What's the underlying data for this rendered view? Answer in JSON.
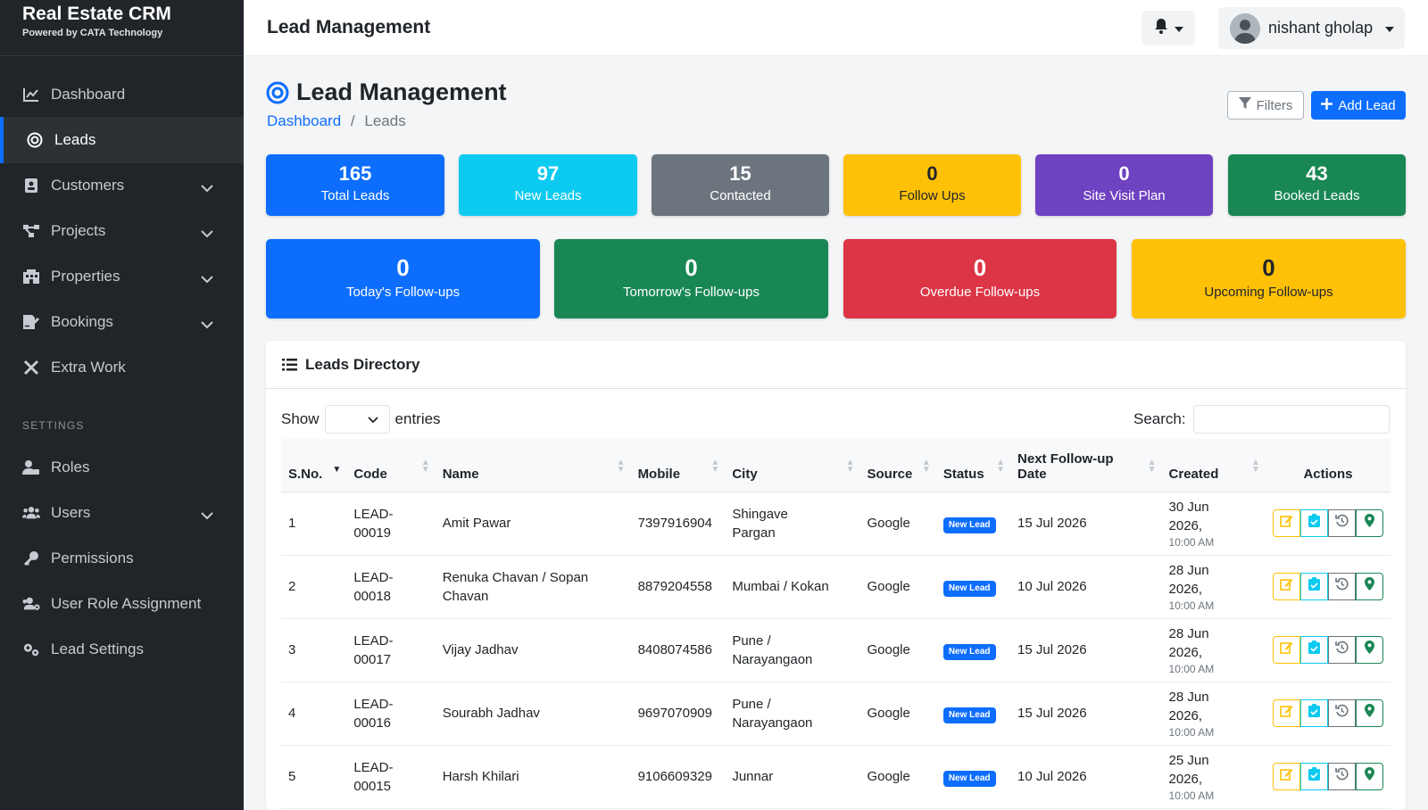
{
  "brand": {
    "title": "Real Estate CRM",
    "subtitle": "Powered by CATA Technology"
  },
  "sidebar": {
    "items": [
      {
        "label": "Dashboard",
        "icon": "chart-line-icon"
      },
      {
        "label": "Leads",
        "icon": "target-icon",
        "active": true
      },
      {
        "label": "Customers",
        "icon": "address-book-icon",
        "expandable": true
      },
      {
        "label": "Projects",
        "icon": "project-diagram-icon",
        "expandable": true
      },
      {
        "label": "Properties",
        "icon": "building-icon",
        "expandable": true
      },
      {
        "label": "Bookings",
        "icon": "file-signature-icon",
        "expandable": true
      },
      {
        "label": "Extra Work",
        "icon": "tools-icon"
      }
    ],
    "section_label": "SETTINGS",
    "settings_items": [
      {
        "label": "Roles",
        "icon": "user-tag-icon"
      },
      {
        "label": "Users",
        "icon": "users-icon",
        "expandable": true
      },
      {
        "label": "Permissions",
        "icon": "key-icon"
      },
      {
        "label": "User Role Assignment",
        "icon": "users-cog-icon"
      },
      {
        "label": "Lead Settings",
        "icon": "cogs-icon"
      }
    ]
  },
  "topbar": {
    "title": "Lead Management",
    "user_name": "nishant gholap"
  },
  "page": {
    "title": "Lead Management",
    "breadcrumb": {
      "home": "Dashboard",
      "separator": "/",
      "current": "Leads"
    },
    "filters_label": "Filters",
    "add_label": "Add Lead"
  },
  "stats_row1": [
    {
      "value": "165",
      "label": "Total Leads",
      "color": "#0d6efd"
    },
    {
      "value": "97",
      "label": "New Leads",
      "color": "#0dcaf0"
    },
    {
      "value": "15",
      "label": "Contacted",
      "color": "#6c757d"
    },
    {
      "value": "0",
      "label": "Follow Ups",
      "color": "#ffc107"
    },
    {
      "value": "0",
      "label": "Site Visit Plan",
      "color": "#6f42c1"
    },
    {
      "value": "43",
      "label": "Booked Leads",
      "color": "#198754"
    }
  ],
  "stats_row2": [
    {
      "value": "0",
      "label": "Today's Follow-ups",
      "color": "#0d6efd"
    },
    {
      "value": "0",
      "label": "Tomorrow's Follow-ups",
      "color": "#198754"
    },
    {
      "value": "0",
      "label": "Overdue Follow-ups",
      "color": "#dc3545"
    },
    {
      "value": "0",
      "label": "Upcoming Follow-ups",
      "color": "#ffc107"
    }
  ],
  "directory": {
    "title": "Leads Directory",
    "show_label": "Show",
    "entries_label": "entries",
    "search_label": "Search:",
    "columns": [
      "S.No.",
      "Code",
      "Name",
      "Mobile",
      "City",
      "Source",
      "Status",
      "Next Follow-up Date",
      "Created",
      "Actions"
    ],
    "rows": [
      {
        "sno": "1",
        "code": "LEAD-00019",
        "name": "Amit Pawar",
        "mobile": "7397916904",
        "city": "Shingave Pargan",
        "source": "Google",
        "status": "New Lead",
        "next": "15 Jul 2026",
        "created_date": "30 Jun 2026,",
        "created_time": "10:00 AM"
      },
      {
        "sno": "2",
        "code": "LEAD-00018",
        "name": "Renuka Chavan / Sopan Chavan",
        "mobile": "8879204558",
        "city": "Mumbai / Kokan",
        "source": "Google",
        "status": "New Lead",
        "next": "10 Jul 2026",
        "created_date": "28 Jun 2026,",
        "created_time": "10:00 AM"
      },
      {
        "sno": "3",
        "code": "LEAD-00017",
        "name": "Vijay Jadhav",
        "mobile": "8408074586",
        "city": "Pune / Narayangaon",
        "source": "Google",
        "status": "New Lead",
        "next": "15 Jul 2026",
        "created_date": "28 Jun 2026,",
        "created_time": "10:00 AM"
      },
      {
        "sno": "4",
        "code": "LEAD-00016",
        "name": "Sourabh Jadhav",
        "mobile": "9697070909",
        "city": "Pune / Narayangaon",
        "source": "Google",
        "status": "New Lead",
        "next": "15 Jul 2026",
        "created_date": "28 Jun 2026,",
        "created_time": "10:00 AM"
      },
      {
        "sno": "5",
        "code": "LEAD-00015",
        "name": "Harsh Khilari",
        "mobile": "9106609329",
        "city": "Junnar",
        "source": "Google",
        "status": "New Lead",
        "next": "10 Jul 2026",
        "created_date": "25 Jun 2026,",
        "created_time": "10:00 AM"
      }
    ]
  }
}
